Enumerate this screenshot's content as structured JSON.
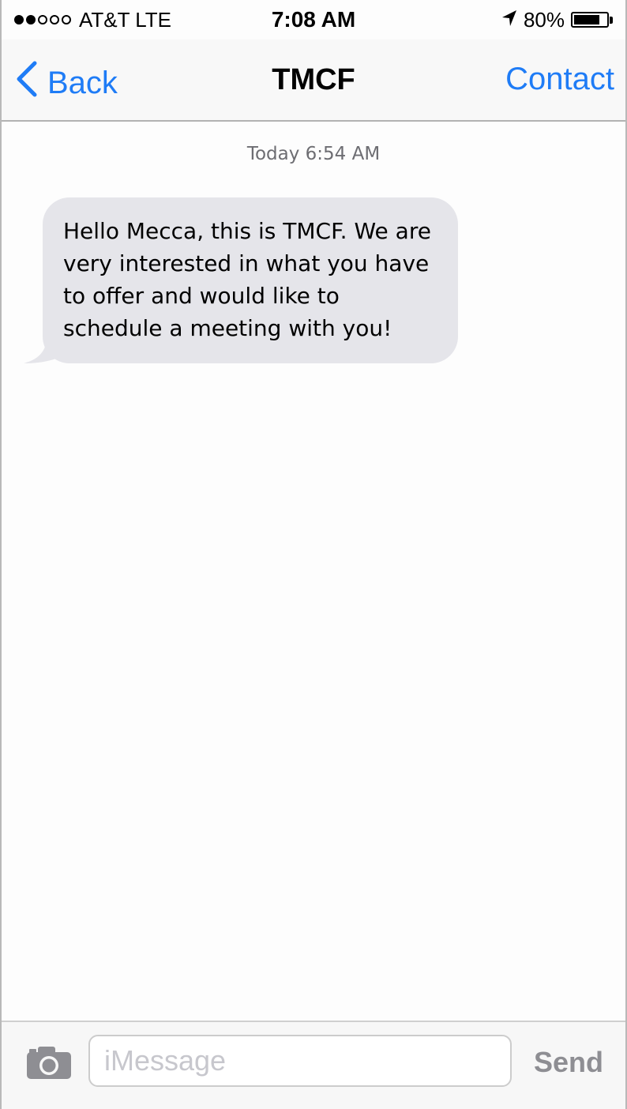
{
  "status_bar": {
    "carrier": "AT&T LTE",
    "time": "7:08 AM",
    "battery": "80%",
    "battery_level": 0.8,
    "signal_bars_filled": 2,
    "signal_bars_total": 5
  },
  "nav": {
    "back_label": "Back",
    "title": "TMCF",
    "contact_label": "Contact"
  },
  "conversation": {
    "timestamp": "Today 6:54 AM",
    "messages": [
      {
        "direction": "incoming",
        "text": "Hello Mecca, this is TMCF. We are very interested in what you have to offer and would like to schedule a meeting with you!"
      }
    ]
  },
  "composer": {
    "placeholder": "iMessage",
    "value": "",
    "send_label": "Send"
  },
  "colors": {
    "accent": "#1f7cf6",
    "incoming_bubble": "#e5e5ea",
    "send_disabled": "#8e8e93"
  },
  "icons": {
    "back": "chevron-left-icon",
    "location": "location-arrow-icon",
    "camera": "camera-icon"
  }
}
